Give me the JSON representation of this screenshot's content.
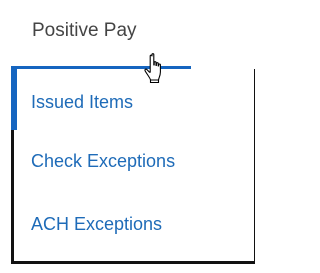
{
  "menu": {
    "top_label": "Positive Pay",
    "items": [
      {
        "label": "Issued Items"
      },
      {
        "label": "Check Exceptions"
      },
      {
        "label": "ACH Exceptions"
      }
    ]
  },
  "colors": {
    "accent": "#1565c0",
    "item_text": "#1e6bb8",
    "top_text": "#444444",
    "border": "#111111"
  },
  "cursor": {
    "icon": "hand-pointer-icon"
  }
}
